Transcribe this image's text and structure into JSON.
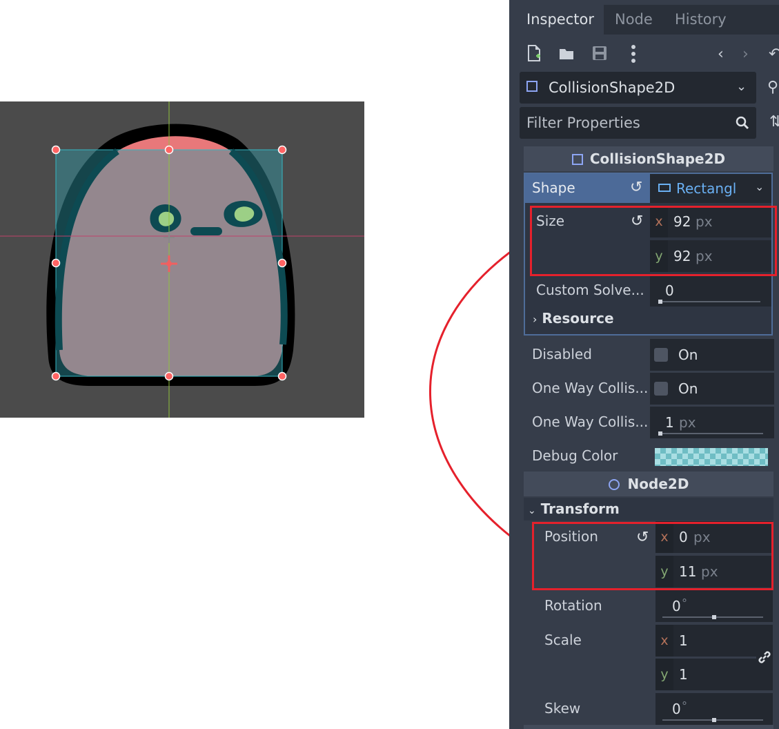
{
  "colors": {
    "highlight": "#e5212c",
    "accent_blue": "#4c6a98",
    "link_blue": "#6ab0f3"
  },
  "viewport": {
    "sprite": "slime-character",
    "handles": "collision-rect-handles"
  },
  "inspector": {
    "tabs": [
      "Inspector",
      "Node",
      "History"
    ],
    "toolbar": {
      "new_icon": "new-resource-icon",
      "open_icon": "open-folder-icon",
      "save_icon": "save-icon",
      "more_icon": "more-vertical-icon",
      "back_icon": "chevron-left-icon",
      "forward_icon": "chevron-right-icon"
    },
    "node_selector": "CollisionShape2D",
    "filter_placeholder": "Filter Properties",
    "collision_section": "CollisionShape2D",
    "shape": {
      "label": "Shape",
      "value": "Rectangl"
    },
    "size": {
      "label": "Size",
      "x": "92",
      "y": "92",
      "unit": "px"
    },
    "custom_solver": {
      "label": "Custom Solve...",
      "value": "0"
    },
    "resource_label": "Resource",
    "disabled": {
      "label": "Disabled",
      "value": "On"
    },
    "one_way_collision": {
      "label": "One Way Collis...",
      "value": "On"
    },
    "one_way_margin": {
      "label": "One Way Collis...",
      "value": "1",
      "unit": "px"
    },
    "debug_color": {
      "label": "Debug Color"
    },
    "node2d_section": "Node2D",
    "transform_label": "Transform",
    "position": {
      "label": "Position",
      "x": "0",
      "y": "11",
      "unit": "px"
    },
    "rotation": {
      "label": "Rotation",
      "value": "0",
      "unit": "°"
    },
    "scale": {
      "label": "Scale",
      "x": "1",
      "y": "1"
    },
    "skew": {
      "label": "Skew",
      "value": "0",
      "unit": "°"
    },
    "axis_x": "x",
    "axis_y": "y"
  }
}
